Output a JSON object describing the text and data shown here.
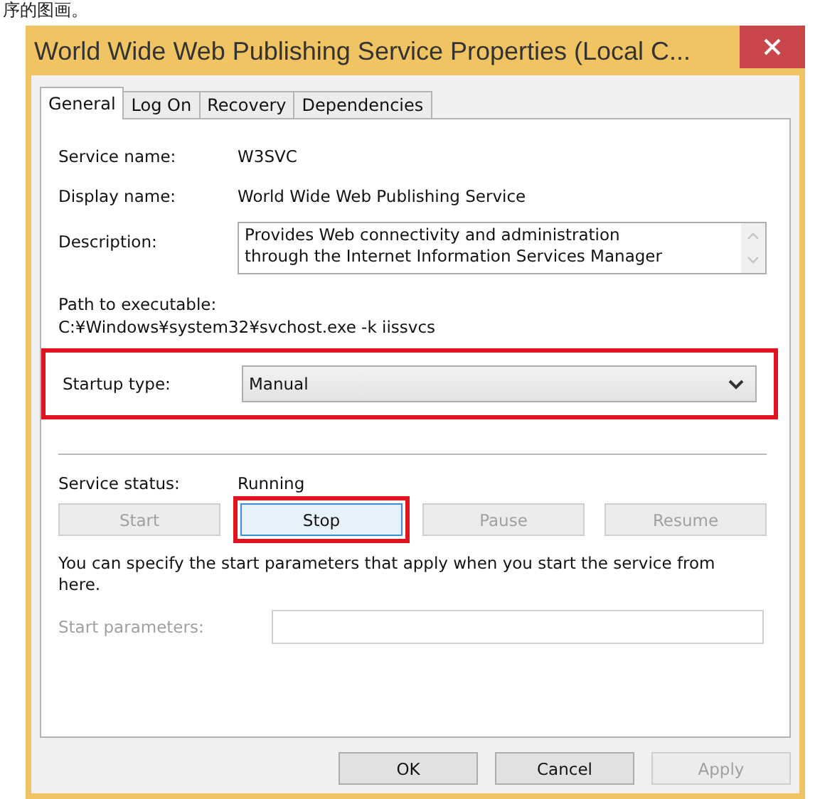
{
  "page_caption": "序的图画。",
  "window": {
    "title": "World Wide Web Publishing Service Properties (Local C..."
  },
  "tabs": [
    {
      "label": "General",
      "selected": true
    },
    {
      "label": "Log On",
      "selected": false
    },
    {
      "label": "Recovery",
      "selected": false
    },
    {
      "label": "Dependencies",
      "selected": false
    }
  ],
  "fields": [
    {
      "kind": "text",
      "label": "Service name:",
      "value": "W3SVC"
    },
    {
      "kind": "text",
      "label": "Display name:",
      "value": "World Wide Web Publishing Service"
    },
    {
      "kind": "textarea",
      "label": "Description:",
      "lines": [
        "Provides Web connectivity and administration",
        "through the Internet Information Services Manager"
      ]
    }
  ],
  "path": {
    "label": "Path to executable:",
    "value": "C:¥Windows¥system32¥svchost.exe -k iissvcs"
  },
  "startup_type": {
    "label": "Startup type:",
    "value": "Manual",
    "highlighted": true
  },
  "service_status": {
    "label": "Service status:",
    "value": "Running"
  },
  "service_buttons": [
    {
      "label": "Start",
      "disabled": true,
      "focused": false,
      "highlighted": false
    },
    {
      "label": "Stop",
      "disabled": false,
      "focused": true,
      "highlighted": true
    },
    {
      "label": "Pause",
      "disabled": true,
      "focused": false,
      "highlighted": false
    },
    {
      "label": "Resume",
      "disabled": true,
      "focused": false,
      "highlighted": false
    }
  ],
  "hint": "You can specify the start parameters that apply when you start the service from here.",
  "start_parameters": {
    "label": "Start parameters:",
    "disabled": true
  },
  "dialog_buttons": [
    {
      "label": "OK",
      "disabled": false
    },
    {
      "label": "Cancel",
      "disabled": false
    },
    {
      "label": "Apply",
      "disabled": true
    }
  ]
}
